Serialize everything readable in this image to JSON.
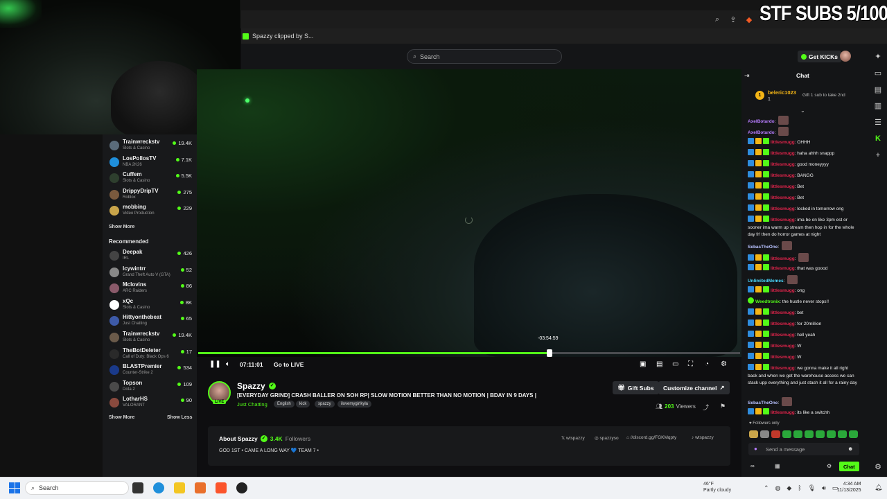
{
  "browser": {
    "bookmark_label": "Spazzy clipped by S...",
    "overlay_text": "STF SUBS 5/100"
  },
  "header": {
    "search_placeholder": "Search",
    "get_kicks_label": "Get KICKs"
  },
  "sidebar": {
    "following": [
      {
        "name": "Trainwreckstv",
        "category": "Slots & Casino",
        "viewers": "19.4K"
      },
      {
        "name": "LosPollosTV",
        "category": "NBA 2K26",
        "viewers": "7.1K"
      },
      {
        "name": "Cuffem",
        "category": "Slots & Casino",
        "viewers": "5.5K"
      },
      {
        "name": "DrippyDripTV",
        "category": "Roblox",
        "viewers": "275"
      },
      {
        "name": "mobbing",
        "category": "Video Production",
        "viewers": "229"
      }
    ],
    "show_more_label": "Show More",
    "recommended_title": "Recommended",
    "recommended": [
      {
        "name": "Deepak",
        "category": "IRL",
        "viewers": "426"
      },
      {
        "name": "Icywintrr",
        "category": "Grand Theft Auto V (GTA)",
        "viewers": "52"
      },
      {
        "name": "Mclovins",
        "category": "ARC Raiders",
        "viewers": "86"
      },
      {
        "name": "xQc",
        "category": "Slots & Casino",
        "viewers": "8K"
      },
      {
        "name": "Hittyonthebeat",
        "category": "Just Chatting",
        "viewers": "65"
      },
      {
        "name": "Trainwreckstv",
        "category": "Slots & Casino",
        "viewers": "19.4K"
      },
      {
        "name": "TheBotDeleter",
        "category": "Call of Duty: Black Ops 6",
        "viewers": "17"
      },
      {
        "name": "BLASTPremier",
        "category": "Counter-Strike 2",
        "viewers": "534"
      },
      {
        "name": "Topson",
        "category": "Dota 2",
        "viewers": "109"
      },
      {
        "name": "LotharHS",
        "category": "VALORANT",
        "viewers": "90"
      }
    ],
    "show_more_label_2": "Show More",
    "show_less_label": "Show Less"
  },
  "player": {
    "elapsed": "07:11:01",
    "go_live_label": "Go to LIVE",
    "seek_tooltip": "-03:54:59",
    "progress": 0.648
  },
  "channel": {
    "name": "Spazzy",
    "live_label": "LIVE",
    "title": "[EVERYDAY GRIND] CRASH BALLER ON SOH RP| SLOW MOTION BETTER THAN NO MOTION | BDAY IN 9 DAYS |",
    "category": "Just Chatting",
    "tags": [
      "English",
      "kick",
      "spazzy",
      "ilovemygirlkyla"
    ],
    "gift_subs_label": "Gift Subs",
    "customize_label": "Customize channel",
    "viewers_count": "203",
    "viewers_label": "Viewers"
  },
  "about": {
    "title": "About Spazzy",
    "followers_count": "3.4K",
    "followers_label": "Followers",
    "bio": "GOD 1ST • CAME A LONG WAY 💙 TEAM 7 •",
    "socials": [
      "wtspazzy",
      "spazzyso",
      "//discord.gg/FGKMqpty",
      "wtspazzy"
    ]
  },
  "chat": {
    "title": "Chat",
    "pinned_user": "beleric1023",
    "pinned_count": "1",
    "pinned_note": "Gift 1 sub to take 2nd",
    "followers_only": "Followers only",
    "input_placeholder": "Send a message",
    "send_label": "Chat",
    "messages": [
      {
        "user": "AxelBotardo",
        "text": "",
        "color": "#b77cff"
      },
      {
        "user": "AxelBotardo",
        "text": "",
        "color": "#b77cff"
      },
      {
        "user": "littlesmugg",
        "text": "OHHH",
        "color": "#e0244b"
      },
      {
        "user": "littlesmugg",
        "text": "haha ahhh snappp",
        "color": "#e0244b"
      },
      {
        "user": "littlesmugg",
        "text": "good moneyyyy",
        "color": "#e0244b"
      },
      {
        "user": "littlesmugg",
        "text": "BANGG",
        "color": "#e0244b"
      },
      {
        "user": "littlesmugg",
        "text": "Bet",
        "color": "#e0244b"
      },
      {
        "user": "littlesmugg",
        "text": "Bet",
        "color": "#e0244b"
      },
      {
        "user": "littlesmugg",
        "text": "locked in tomorrow ong",
        "color": "#e0244b"
      },
      {
        "user": "littlesmugg",
        "text": "ima be on like 3pm est or sooner ima warm up stream then hop in for the whole day fr! then do horror games at night",
        "color": "#e0244b"
      },
      {
        "user": "SebasTheOne",
        "text": "",
        "color": "#b8c2ff"
      },
      {
        "user": "littlesmugg",
        "text": "",
        "color": "#e0244b"
      },
      {
        "user": "littlesmugg",
        "text": "that was goood",
        "color": "#e0244b"
      },
      {
        "user": "UnlimitedMemes",
        "text": "",
        "color": "#4ad9ff"
      },
      {
        "user": "littlesmugg",
        "text": "ong",
        "color": "#e0244b"
      },
      {
        "user": "Weedtronix",
        "text": "the hustle never stops!!",
        "color": "#53fc18"
      },
      {
        "user": "littlesmugg",
        "text": "bet",
        "color": "#e0244b"
      },
      {
        "user": "littlesmugg",
        "text": "for 20million",
        "color": "#e0244b"
      },
      {
        "user": "littlesmugg",
        "text": "hell yeah",
        "color": "#e0244b"
      },
      {
        "user": "littlesmugg",
        "text": "W",
        "color": "#e0244b"
      },
      {
        "user": "littlesmugg",
        "text": "W",
        "color": "#e0244b"
      },
      {
        "user": "littlesmugg",
        "text": "we gonna make it all right back and when we get the warehouse access we can stack upp everything and just stash it all for a rainy day",
        "color": "#e0244b"
      },
      {
        "user": "SebasTheOne",
        "text": "",
        "color": "#b8c2ff"
      },
      {
        "user": "littlesmugg",
        "text": "its like a switchh",
        "color": "#e0244b"
      }
    ]
  },
  "taskbar": {
    "search_placeholder": "Search",
    "weather_temp": "46°F",
    "weather_desc": "Partly cloudy",
    "time": "4:34 AM",
    "date": "11/13/2025"
  },
  "colors": {
    "accent": "#53fc18",
    "background": "#0e0e10",
    "panel": "#18191b"
  }
}
